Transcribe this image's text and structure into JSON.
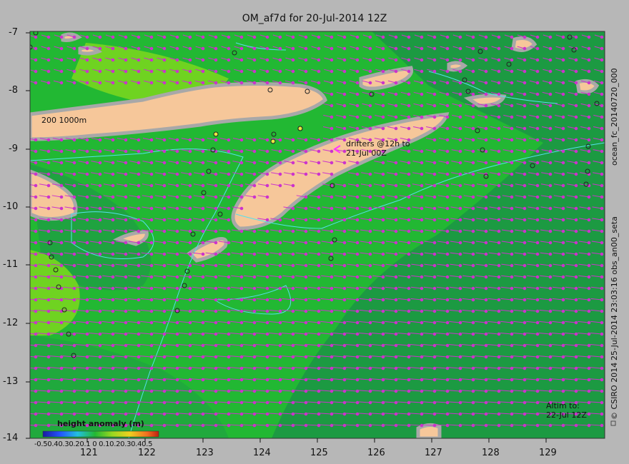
{
  "title": "OM_af7d for 20-Jul-2014 12Z",
  "side_labels": {
    "forecast": "ocean_fc_20140720_000",
    "obs": "25-Jul-2014 23:03:16  obs_an00_seta",
    "copyright": "© CSIRO 2014"
  },
  "axes": {
    "lat_ticks": [
      "-7",
      "-8",
      "-9",
      "-10",
      "-11",
      "-12",
      "-13",
      "-14"
    ],
    "lon_ticks": [
      "121",
      "122",
      "123",
      "124",
      "125",
      "126",
      "127",
      "128",
      "129"
    ]
  },
  "annotations": {
    "isobaths": "200  1000m",
    "drifters_line1": "drifters @12h to",
    "drifters_line2": "21-Jul 00Z",
    "altim_line1": "Altim to:",
    "altim_line2": "22-Jul 12Z"
  },
  "legend": {
    "title": "height anomaly  (m)",
    "ticks": "-0.50.40.30.20.1 0 0.10.20.30.40.5"
  },
  "colors": {
    "background": "#b7b7b7",
    "ocean_main": "#22b833",
    "ocean_dark": "#1c9a42",
    "ocean_light": "#6fd321",
    "land": "#f6c79a",
    "land_rim": "#a8a8a8",
    "current_vectors": "#cc33cc",
    "contours": "#55e0ee"
  }
}
